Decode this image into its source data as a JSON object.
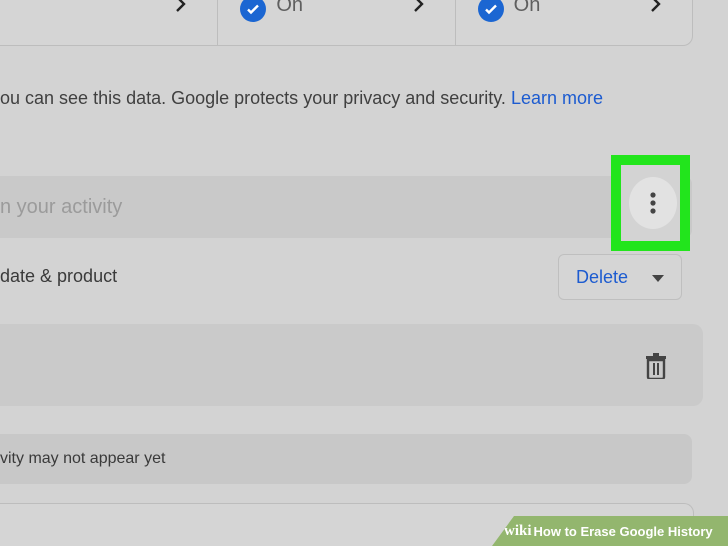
{
  "top_settings": [
    {
      "status": ""
    },
    {
      "status": "On"
    },
    {
      "status": "On"
    }
  ],
  "privacy": {
    "text": "ou can see this data. Google protects your privacy and security.",
    "link": "Learn more"
  },
  "search": {
    "placeholder": "n your activity"
  },
  "filter": {
    "label": "date & product"
  },
  "delete_button": {
    "label": "Delete"
  },
  "notice": {
    "text": "vity may not appear yet"
  },
  "watermark": {
    "wiki": "wiki",
    "title": "How to Erase Google History"
  },
  "colors": {
    "highlight": "#22e51c",
    "link": "#1c5bd0",
    "check": "#1b66d2"
  }
}
